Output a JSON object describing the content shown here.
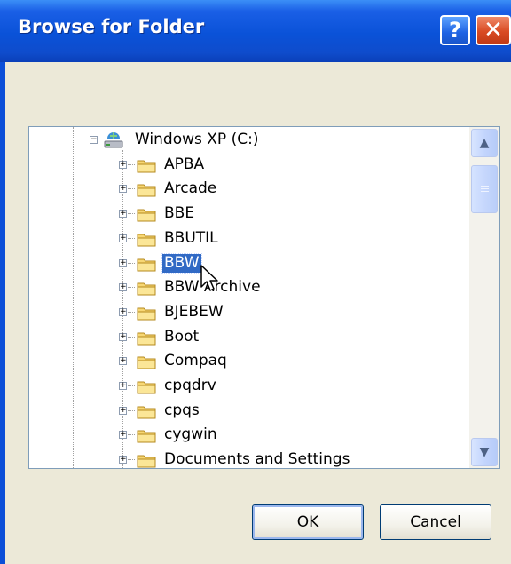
{
  "dialog": {
    "title": "Browse for Folder",
    "help_label": "?",
    "close_label": "✕"
  },
  "tree": {
    "root": {
      "label": "Windows XP (C:)",
      "icon": "drive-icon"
    },
    "items": [
      {
        "label": "APBA",
        "selected": false
      },
      {
        "label": "Arcade",
        "selected": false
      },
      {
        "label": "BBE",
        "selected": false
      },
      {
        "label": "BBUTIL",
        "selected": false
      },
      {
        "label": "BBW",
        "selected": true
      },
      {
        "label": "BBW Archive",
        "selected": false
      },
      {
        "label": "BJEBEW",
        "selected": false
      },
      {
        "label": "Boot",
        "selected": false
      },
      {
        "label": "Compaq",
        "selected": false
      },
      {
        "label": "cpqdrv",
        "selected": false
      },
      {
        "label": "cpqs",
        "selected": false
      },
      {
        "label": "cygwin",
        "selected": false
      },
      {
        "label": "Documents and Settings",
        "selected": false
      }
    ],
    "expander_collapsed": "+",
    "expander_expanded": "−"
  },
  "scrollbar": {
    "up_arrow": "▲",
    "down_arrow": "▼"
  },
  "buttons": {
    "ok_label": "OK",
    "cancel_label": "Cancel"
  },
  "colors": {
    "titlebar": "#0a52d8",
    "selection": "#316ac5",
    "dialog_face": "#ece9d8"
  }
}
